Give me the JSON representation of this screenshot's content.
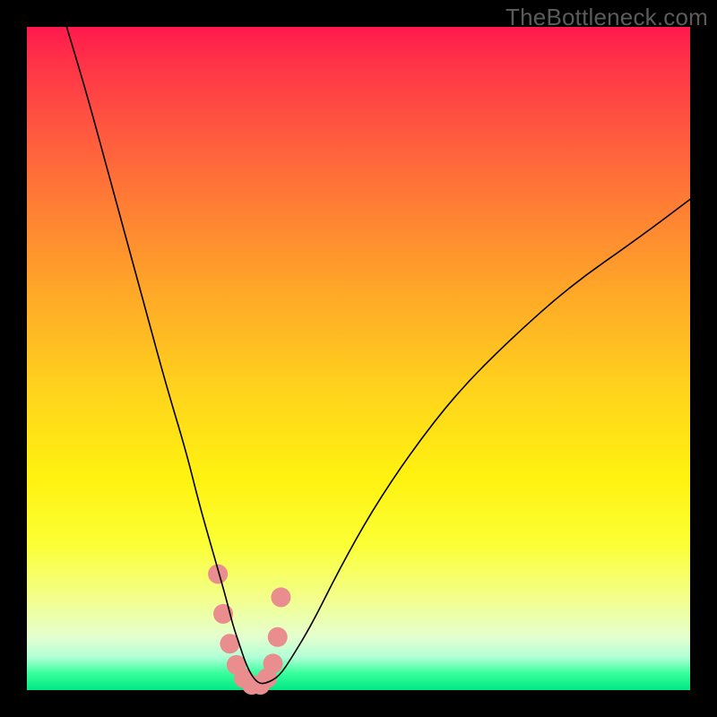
{
  "watermark": "TheBottleneck.com",
  "chart_data": {
    "type": "line",
    "title": "",
    "xlabel": "",
    "ylabel": "",
    "xlim": [
      0,
      100
    ],
    "ylim": [
      0,
      100
    ],
    "grid": false,
    "legend": false,
    "series": [
      {
        "name": "bottleneck-curve",
        "stroke": "#000000",
        "stroke_width": 1.6,
        "x": [
          6,
          9,
          12,
          15,
          18,
          21,
          24,
          26,
          28,
          30,
          31,
          32,
          33,
          34,
          35,
          36,
          38,
          40,
          43,
          47,
          52,
          58,
          65,
          73,
          82,
          92,
          100
        ],
        "y": [
          100,
          90,
          79,
          68,
          57,
          46,
          36,
          28,
          21,
          14,
          10,
          7,
          4,
          2,
          1,
          1,
          2,
          5,
          10,
          18,
          27,
          36,
          45,
          53,
          61,
          68,
          74
        ]
      },
      {
        "name": "marker-dots",
        "type": "scatter",
        "color": "#e98d8e",
        "radius": 11,
        "x": [
          28.8,
          29.6,
          30.6,
          31.6,
          32.7,
          33.9,
          35.2,
          36.2,
          37.1,
          37.8,
          38.3
        ],
        "y": [
          17.5,
          11.5,
          7.0,
          3.8,
          1.8,
          0.8,
          0.8,
          1.8,
          4.0,
          8.0,
          14.0
        ]
      }
    ],
    "gradient_stops": [
      {
        "pct": 0,
        "color": "#ff1a4d"
      },
      {
        "pct": 15,
        "color": "#ff5640"
      },
      {
        "pct": 40,
        "color": "#ffa828"
      },
      {
        "pct": 68,
        "color": "#fff210"
      },
      {
        "pct": 92,
        "color": "#e4ffcf"
      },
      {
        "pct": 100,
        "color": "#00e884"
      }
    ]
  }
}
